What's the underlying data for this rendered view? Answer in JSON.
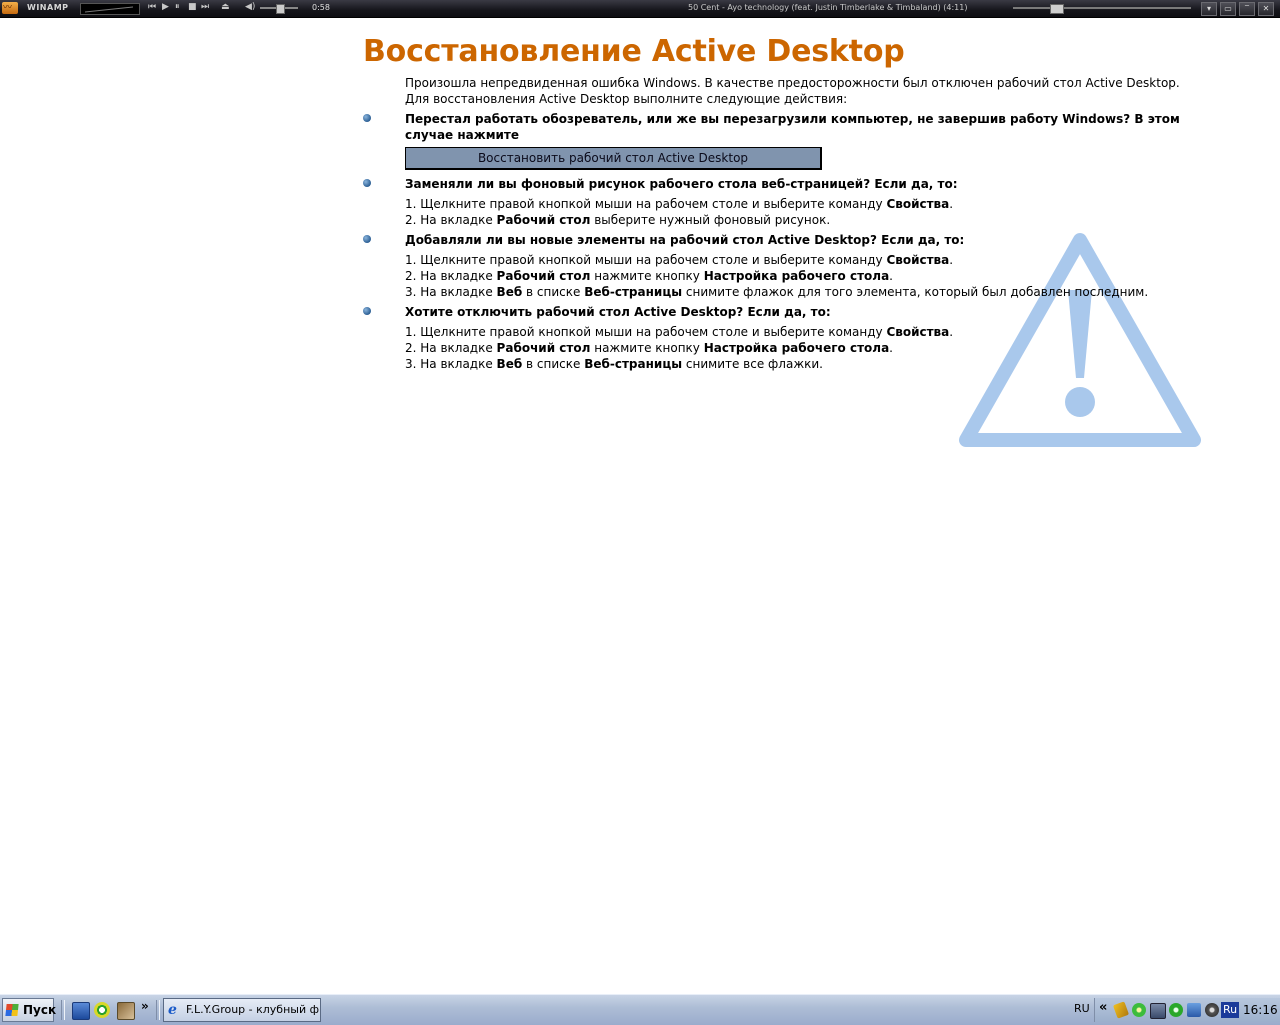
{
  "winamp": {
    "brand": "WINAMP",
    "time": "0:58",
    "track_title": "50 Cent - Ayo technology (feat. Justin Timberlake & Timbaland) (4:11)",
    "volume_level": 0.45,
    "seek_position": 0.23,
    "controls": [
      "previous",
      "play",
      "pause",
      "stop",
      "next",
      "eject"
    ]
  },
  "page": {
    "title": "Восстановление Active Desktop",
    "intro_line1": "Произошла непредвиденная ошибка Windows. В качестве предосторожности был отключен рабочий стол Active Desktop.",
    "intro_line2": "Для восстановления Active Desktop выполните следующие действия:",
    "sections": [
      {
        "question": "Перестал работать обозреватель, или же вы перезагрузили компьютер, не завершив работу Windows? В этом случае нажмите",
        "button_label": "Восстановить рабочий стол Active Desktop"
      },
      {
        "question": "Заменяли ли вы фоновый рисунок рабочего стола веб-страницей? Если да, то:",
        "steps": [
          {
            "pre": "1. Щелкните правой кнопкой мыши на рабочем столе и выберите команду ",
            "b1": "Свойства",
            "post": "."
          },
          {
            "pre": "2. На вкладке ",
            "b1": "Рабочий стол",
            "post": " выберите нужный фоновый рисунок."
          }
        ]
      },
      {
        "question": "Добавляли ли вы новые элементы на рабочий стол Active Desktop? Если да, то:",
        "steps": [
          {
            "pre": "1. Щелкните правой кнопкой мыши на рабочем столе и выберите команду ",
            "b1": "Свойства",
            "post": "."
          },
          {
            "pre": "2. На вкладке ",
            "b1": "Рабочий стол",
            "mid": " нажмите кнопку ",
            "b2": "Настройка рабочего стола",
            "post": "."
          },
          {
            "pre": "3. На вкладке ",
            "b1": "Веб",
            "mid": " в списке ",
            "b2": "Веб-страницы",
            "post": " снимите флажок для того элемента, который был добавлен последним."
          }
        ]
      },
      {
        "question": "Хотите отключить рабочий стол Active Desktop? Если да, то:",
        "steps": [
          {
            "pre": "1. Щелкните правой кнопкой мыши на рабочем столе и выберите команду ",
            "b1": "Свойства",
            "post": "."
          },
          {
            "pre": "2. На вкладке ",
            "b1": "Рабочий стол",
            "mid": " нажмите кнопку ",
            "b2": "Настройка рабочего стола",
            "post": "."
          },
          {
            "pre": "3. На вкладке ",
            "b1": "Веб",
            "mid": " в списке ",
            "b2": "Веб-страницы",
            "post": " снимите все флажки."
          }
        ]
      }
    ]
  },
  "taskbar": {
    "start_label": "Пуск",
    "quicklaunch_more": "»",
    "task_label": "F.L.Y.Group - клубный ф...",
    "lang_indicator": "RU",
    "tray_expand": "«",
    "tray_lang": "Ru",
    "clock": "16:16"
  },
  "colors": {
    "title": "#cc6600",
    "warning": "#a9c8ec",
    "button": "#8094ae",
    "bullet": "#2c5f94"
  }
}
